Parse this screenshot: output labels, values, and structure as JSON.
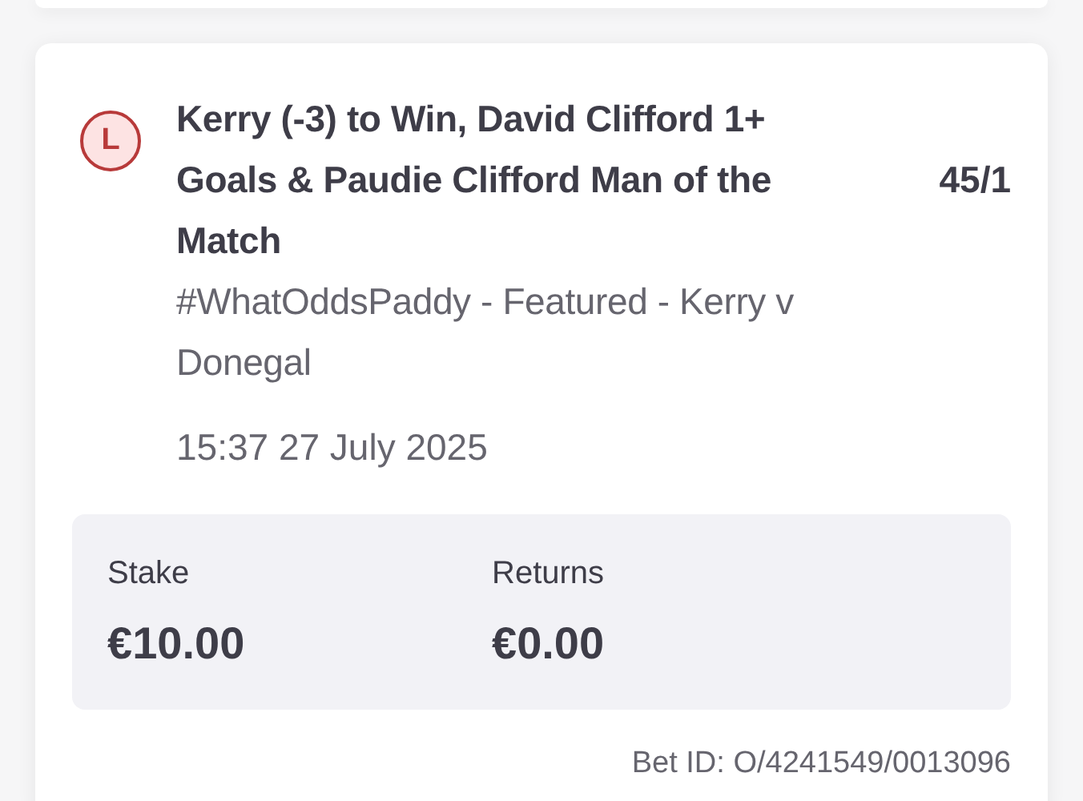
{
  "bet": {
    "result": {
      "letter": "L",
      "kind": "lost"
    },
    "selection": "Kerry (-3) to Win, David Clifford 1+ Goals & Paudie Clifford Man of the Match",
    "odds": "45/1",
    "market": "#WhatOddsPaddy - Featured - Kerry v Donegal",
    "placed": "15:37 27 July 2025",
    "stake_label": "Stake",
    "stake": "€10.00",
    "returns_label": "Returns",
    "returns": "€0.00",
    "bet_id": "Bet ID: O/4241549/0013096"
  }
}
